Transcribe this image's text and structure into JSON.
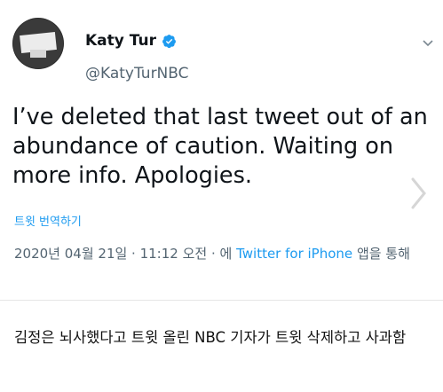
{
  "tweet": {
    "display_name": "Katy Tur",
    "handle": "@KatyTurNBC",
    "verified": true,
    "text": "I’ve deleted that last tweet out of an abundance of caution. Waiting on more info. Apologies.",
    "translate_label": "트윗 번역하기",
    "timestamp": "2020년 04월 21일 · 11:12 오전 · 에",
    "source": "Twitter for iPhone",
    "source_suffix": "앱을 통해"
  },
  "caption": "김정은 뇌사했다고 트윗 올린 NBC 기자가 트윗 삭제하고 사과함",
  "colors": {
    "accent": "#1d9bf0",
    "muted": "#536471",
    "text": "#0f1419"
  },
  "icons": {
    "verified": "verified-badge-icon",
    "more": "chevron-down-icon",
    "next": "chevron-right-icon"
  }
}
